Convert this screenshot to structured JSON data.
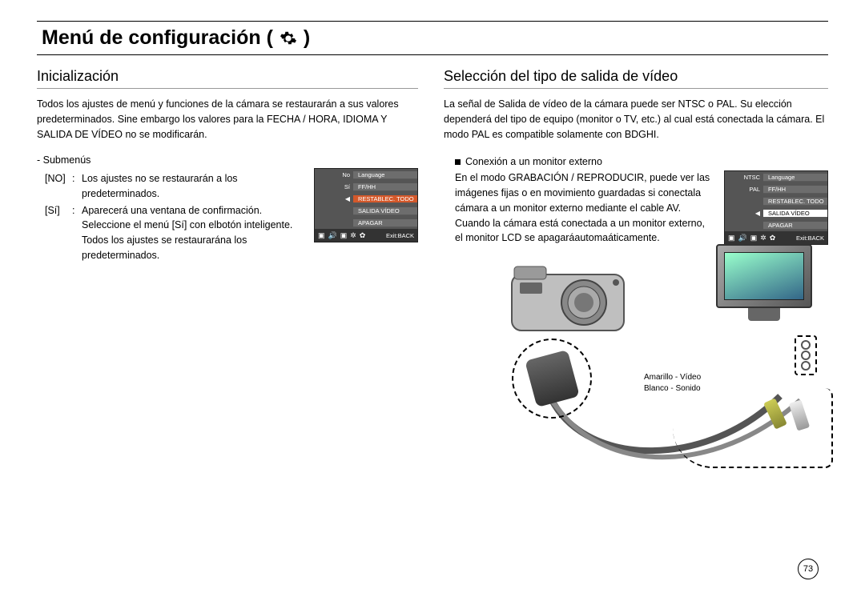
{
  "title_prefix": "Menú de configuración (",
  "title_suffix": ")",
  "page_number": "73",
  "left": {
    "heading": "Inicialización",
    "para": "Todos los ajustes de menú y funciones de la cámara se restaurarán a sus valores predeterminados. Sine embargo los valores para la FECHA / HORA, IDIOMA Y SALIDA DE VÍDEO no se modificarán.",
    "submenus_label": "- Submenús",
    "item1_key": "[NO]",
    "item1_sep": ":",
    "item1_val": "Los ajustes no se restaurarán a los predeterminados.",
    "item2_key": "[Sí]",
    "item2_sep": ":",
    "item2_val": "Aparecerá una ventana de confirmación. Seleccione el menú [Sí] con elbotón inteligente. Todos los ajustes se restaurarána los predeterminados.",
    "lcd": {
      "r1_left": "No",
      "r1_right": "Language",
      "r2_left": "Sí",
      "r2_right": "FF/HH",
      "r3_left": "◀",
      "r3_right": "RESTABLEC. TODO",
      "r4_left": "",
      "r4_right": "SALIDA VÍDEO",
      "r5_left": "",
      "r5_right": "APAGAR",
      "exit": "Exit:BACK"
    }
  },
  "right": {
    "heading": "Selección del tipo de salida de vídeo",
    "para": "La señal de Salida de vídeo de la cámara puede ser NTSC o PAL. Su elección dependerá del tipo de equipo (monitor o TV, etc.) al cual está conectada la cámara. El modo PAL es compatible solamente con BDGHI.",
    "bullet": "Conexión a un monitor externo",
    "para2": "En el modo GRABACIÓN / REPRODUCIR, puede ver las imágenes fijas o en movimiento guardadas si conectala cámara a un monitor externo mediante el cable AV. Cuando la cámara está conectada a un monitor externo, el monitor LCD se apagaráautomaáticamente.",
    "lcd": {
      "r1_left": "NTSC",
      "r1_right": "Language",
      "r2_left": "PAL",
      "r2_right": "FF/HH",
      "r3_left": "",
      "r3_right": "RESTABLEC. TODO",
      "r4_left": "◀",
      "r4_right": "SALIDA VÍDEO",
      "r5_left": "",
      "r5_right": "APAGAR",
      "exit": "Exit:BACK"
    },
    "cable_label1": "Amarillo - Vídeo",
    "cable_label2": "Blanco - Sonido"
  }
}
